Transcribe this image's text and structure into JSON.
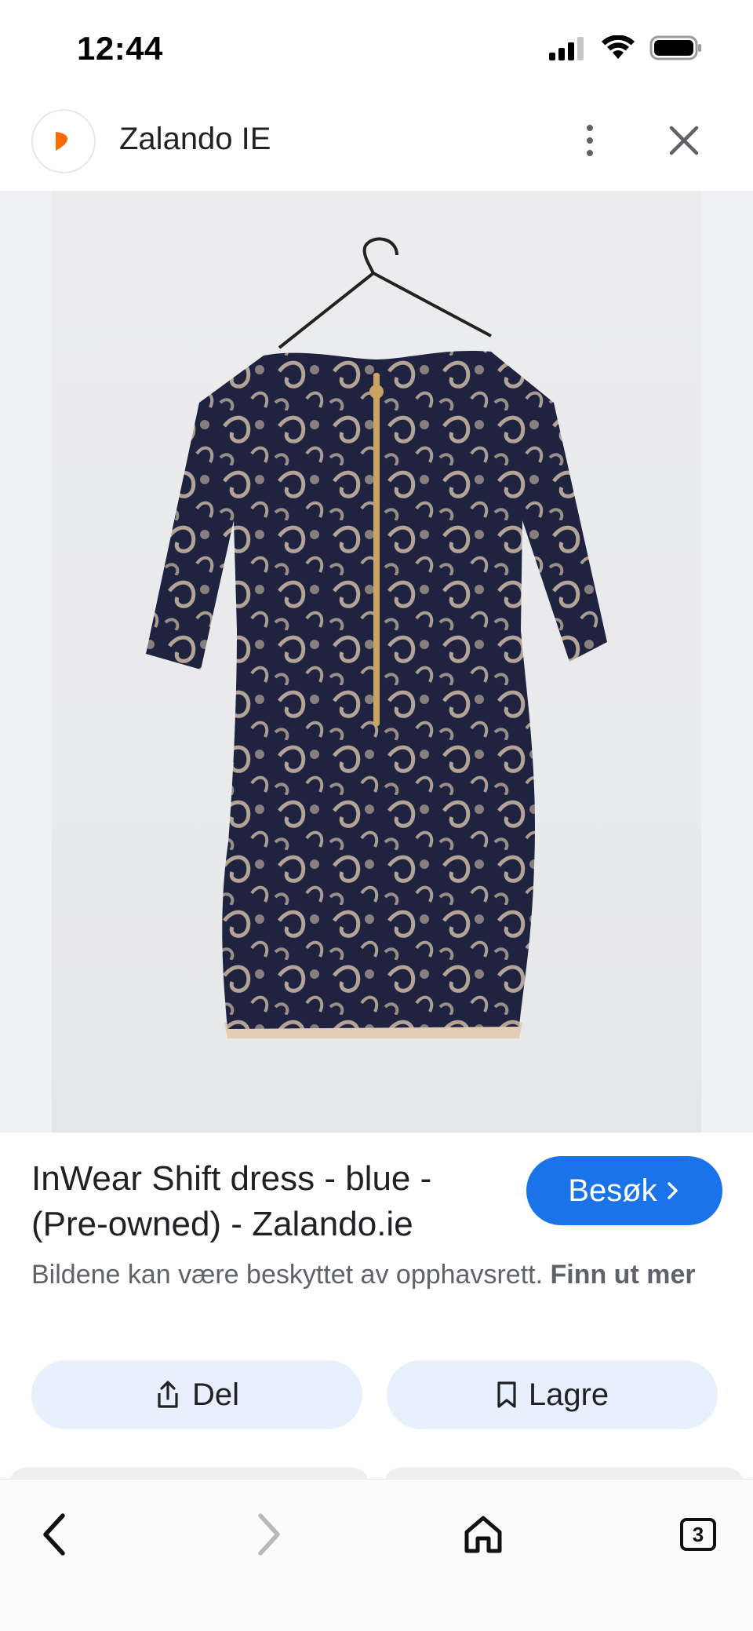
{
  "status_bar": {
    "time": "12:44"
  },
  "header": {
    "site_name": "Zalando IE",
    "favicon_color": "#ff6900"
  },
  "image": {
    "subject": "navy lace shift dress on hanger"
  },
  "result": {
    "title": "InWear Shift dress - blue - (Pre-owned) - Zalando.ie",
    "visit_label": "Besøk",
    "copyright_text": "Bildene kan være beskyttet av opphavsrett.",
    "copyright_link": "Finn ut mer",
    "share_label": "Del",
    "save_label": "Lagre"
  },
  "bottom_nav": {
    "tab_count": "3"
  },
  "colors": {
    "accent": "#1a73e8",
    "action_bg": "#e8f0fe",
    "dress": "#1f2340",
    "lining": "#d9c8b4",
    "zipper": "#c9a463"
  }
}
